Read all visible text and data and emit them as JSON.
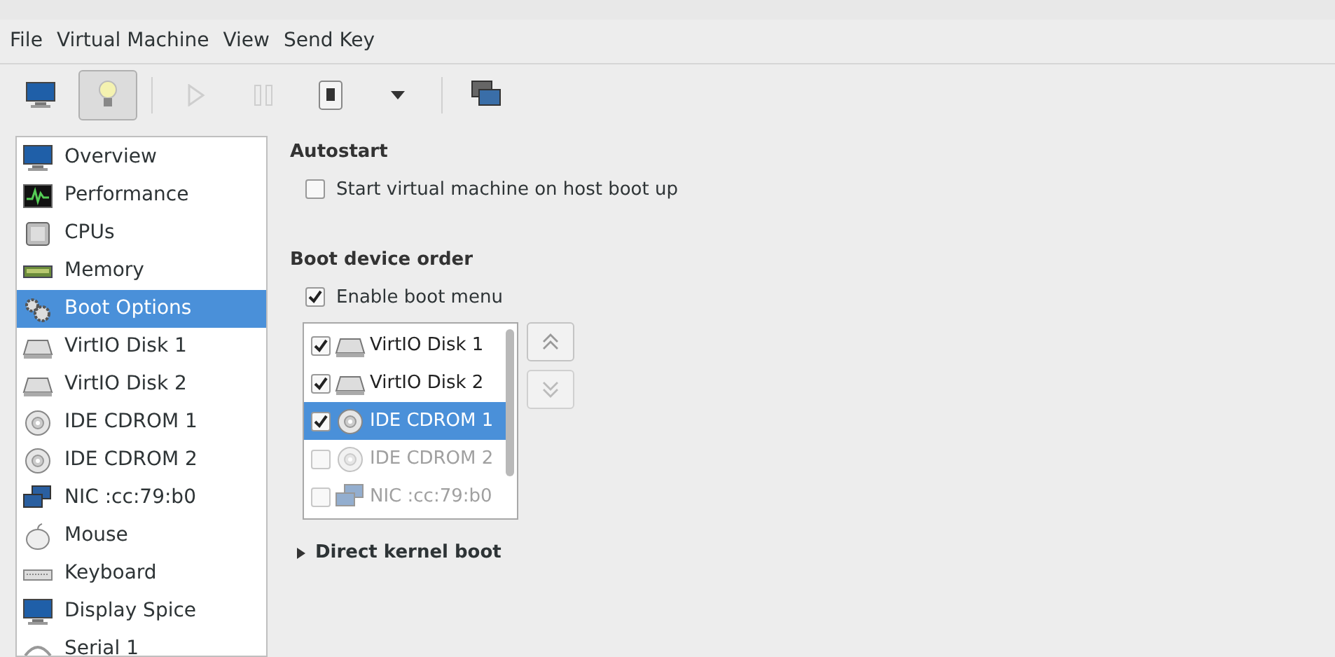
{
  "menu": [
    "File",
    "Virtual Machine",
    "View",
    "Send Key"
  ],
  "toolbar": [
    {
      "kind": "monitor",
      "selected": false,
      "disabled": false
    },
    {
      "kind": "bulb",
      "selected": true,
      "disabled": false
    },
    {
      "kind": "sep"
    },
    {
      "kind": "play",
      "selected": false,
      "disabled": true
    },
    {
      "kind": "pause",
      "selected": false,
      "disabled": true
    },
    {
      "kind": "power",
      "selected": false,
      "disabled": false
    },
    {
      "kind": "caret",
      "selected": false,
      "disabled": false
    },
    {
      "kind": "sep"
    },
    {
      "kind": "screens",
      "selected": false,
      "disabled": false
    }
  ],
  "sidebar": {
    "items": [
      {
        "label": "Overview",
        "kind": "monitor",
        "selected": false
      },
      {
        "label": "Performance",
        "kind": "graph",
        "selected": false
      },
      {
        "label": "CPUs",
        "kind": "chip",
        "selected": false
      },
      {
        "label": "Memory",
        "kind": "ram",
        "selected": false
      },
      {
        "label": "Boot Options",
        "kind": "gears",
        "selected": true
      },
      {
        "label": "VirtIO Disk 1",
        "kind": "disk",
        "selected": false
      },
      {
        "label": "VirtIO Disk 2",
        "kind": "disk",
        "selected": false
      },
      {
        "label": "IDE CDROM 1",
        "kind": "cdrom",
        "selected": false
      },
      {
        "label": "IDE CDROM 2",
        "kind": "cdrom",
        "selected": false
      },
      {
        "label": "NIC :cc:79:b0",
        "kind": "nic",
        "selected": false
      },
      {
        "label": "Mouse",
        "kind": "mouse",
        "selected": false
      },
      {
        "label": "Keyboard",
        "kind": "keyboard",
        "selected": false
      },
      {
        "label": "Display Spice",
        "kind": "monitor",
        "selected": false
      },
      {
        "label": "Serial 1",
        "kind": "serial",
        "selected": false
      }
    ]
  },
  "autostart": {
    "heading": "Autostart",
    "option": {
      "label": "Start virtual machine on host boot up",
      "checked": false
    }
  },
  "boot_order": {
    "heading": "Boot device order",
    "enable_menu": {
      "label": "Enable boot menu",
      "checked": true
    },
    "devices": [
      {
        "label": "VirtIO Disk 1",
        "kind": "disk",
        "checked": true,
        "selected": false
      },
      {
        "label": "VirtIO Disk 2",
        "kind": "disk",
        "checked": true,
        "selected": false
      },
      {
        "label": "IDE CDROM 1",
        "kind": "cdrom",
        "checked": true,
        "selected": true
      },
      {
        "label": "IDE CDROM 2",
        "kind": "cdrom",
        "checked": false,
        "selected": false
      },
      {
        "label": "NIC :cc:79:b0",
        "kind": "nic",
        "checked": false,
        "selected": false
      }
    ]
  },
  "direct_kernel_boot": {
    "label": "Direct kernel boot",
    "expanded": false
  }
}
